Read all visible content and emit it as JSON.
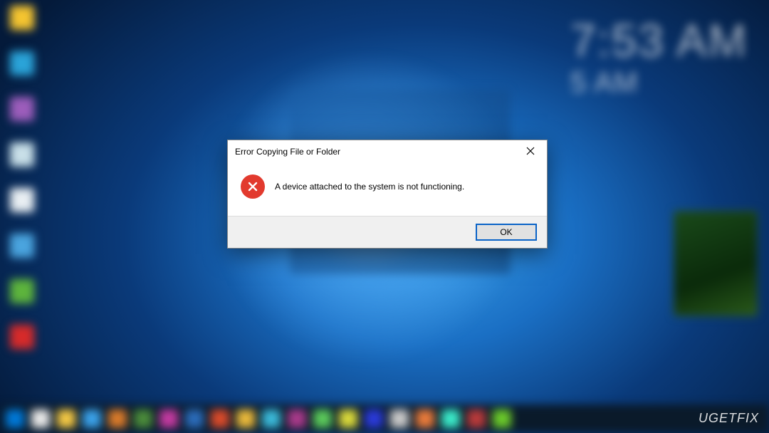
{
  "dialog": {
    "title": "Error Copying File or Folder",
    "message": "A device attached to the system is not functioning.",
    "ok_label": "OK"
  },
  "clock": {
    "primary": "7:53 AM",
    "secondary": "5 AM"
  },
  "watermark": "UGETFIX",
  "desktop_icons": [
    {
      "color": "#f4c430"
    },
    {
      "color": "#2aa3d8"
    },
    {
      "color": "#9c5dbb"
    },
    {
      "color": "#c8dfe8"
    },
    {
      "color": "#e8eef2"
    },
    {
      "color": "#4aa4de"
    },
    {
      "color": "#5db43c"
    },
    {
      "color": "#d62a2a"
    }
  ],
  "taskbar_icons": [
    {
      "color": "#0078d7"
    },
    {
      "color": "#e8e8e8"
    },
    {
      "color": "#f2c744"
    },
    {
      "color": "#3aa0e8"
    },
    {
      "color": "#d87a2a"
    },
    {
      "color": "#4a8a3a"
    },
    {
      "color": "#c23aa0"
    },
    {
      "color": "#2a6ab8"
    },
    {
      "color": "#d84a2a"
    },
    {
      "color": "#e8b83a"
    },
    {
      "color": "#3ab8d8"
    },
    {
      "color": "#a83a8a"
    },
    {
      "color": "#5ac85a"
    },
    {
      "color": "#d8d83a"
    },
    {
      "color": "#2a3ad8"
    },
    {
      "color": "#c8c8c8"
    },
    {
      "color": "#e87a3a"
    },
    {
      "color": "#3ae8c8"
    },
    {
      "color": "#b83a3a"
    },
    {
      "color": "#6ac82a"
    }
  ]
}
